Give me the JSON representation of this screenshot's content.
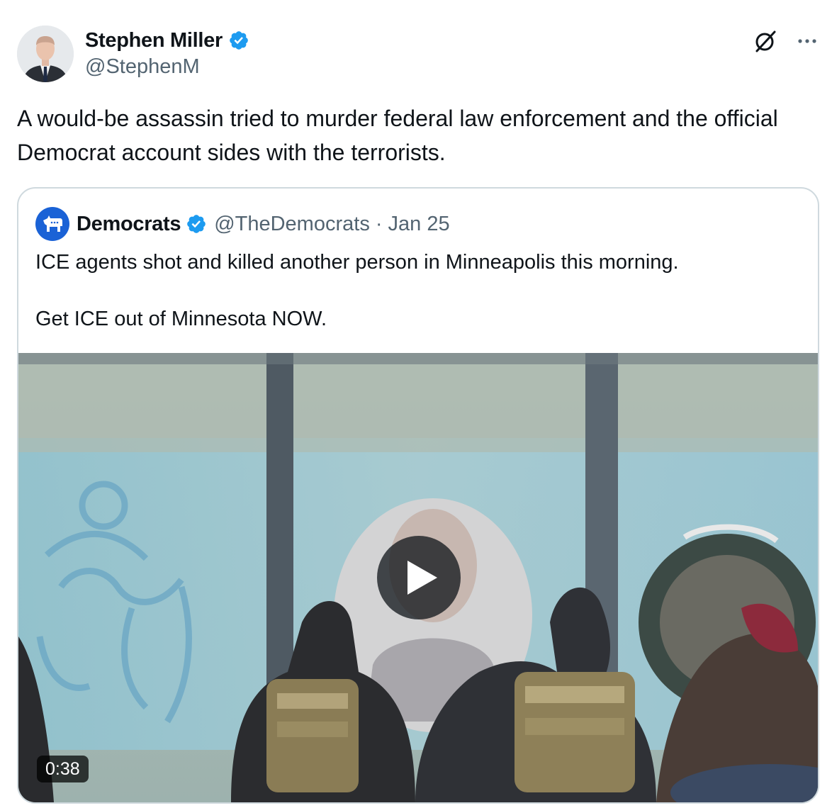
{
  "author": {
    "name": "Stephen Miller",
    "handle": "@StephenM",
    "verified": true,
    "avatar_icon": "profile-photo"
  },
  "icons": {
    "grok": "grok-icon",
    "more": "more-icon"
  },
  "tweet": {
    "text": "A would-be assassin tried to murder federal law enforcement and the official Democrat account sides with the terrorists."
  },
  "quoted": {
    "name": "Democrats",
    "handle": "@TheDemocrats",
    "separator": "·",
    "date": "Jan 25",
    "verified": true,
    "avatar_icon": "donkey-logo-icon",
    "text_line1": "ICE agents shot and killed another person in Minneapolis this morning.",
    "text_line2": "Get ICE out of Minnesota NOW.",
    "video": {
      "duration": "0:38",
      "play_icon": "play-icon"
    }
  },
  "colors": {
    "text": "#0f1419",
    "secondary": "#536471",
    "verified_blue": "#1d9bf0",
    "border": "#cfd9de",
    "democrats_blue": "#1a62d6"
  }
}
